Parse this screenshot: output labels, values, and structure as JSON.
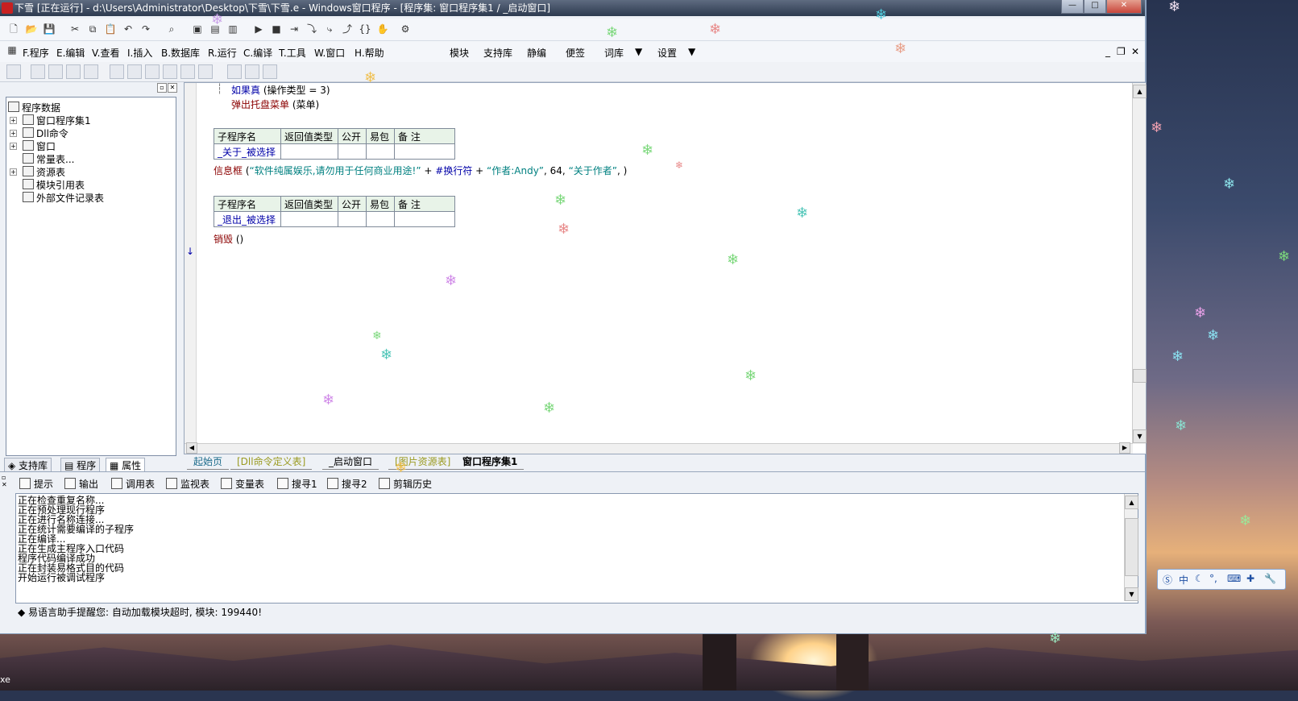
{
  "window": {
    "title": "下雪 [正在运行] - d:\\Users\\Administrator\\Desktop\\下雪\\下雪.e - Windows窗口程序 - [程序集: 窗口程序集1 / _启动窗口]"
  },
  "menu": {
    "items": [
      {
        "key": "F",
        "label": "F.程序"
      },
      {
        "key": "E",
        "label": "E.编辑"
      },
      {
        "key": "V",
        "label": "V.查看"
      },
      {
        "key": "I",
        "label": "I.插入"
      },
      {
        "key": "B",
        "label": "B.数据库"
      },
      {
        "key": "R",
        "label": "R.运行"
      },
      {
        "key": "C",
        "label": "C.编译"
      },
      {
        "key": "T",
        "label": "T.工具"
      },
      {
        "key": "W",
        "label": "W.窗口"
      },
      {
        "key": "H",
        "label": "H.帮助"
      }
    ],
    "right_items": [
      "模块",
      "支持库",
      "静编",
      "便签",
      "词库",
      "设置"
    ]
  },
  "tree": {
    "items": [
      "程序数据",
      "窗口程序集1",
      "Dll命令",
      "窗口",
      "常量表...",
      "资源表",
      "模块引用表",
      "外部文件记录表"
    ]
  },
  "left_tabs": [
    "支持库",
    "程序",
    "属性"
  ],
  "editor": {
    "line_if": "如果真",
    "line_if_args": " (操作类型 = 3)",
    "line_popup": "弹出托盘菜单",
    "line_popup_args": " (菜单)",
    "table_headers": [
      "子程序名",
      "返回值类型",
      "公开",
      "易包",
      "备 注"
    ],
    "sub1_name": "_关于_被选择",
    "msgbox_fn": "信息框",
    "msgbox_open": " (",
    "msgbox_str1": "“软件纯属娱乐,请勿用于任何商业用途!”",
    "msgbox_plus1": " + ",
    "msgbox_newline": "#换行符",
    "msgbox_plus2": " + ",
    "msgbox_str2": "“作者:Andy”",
    "msgbox_num": ", 64, ",
    "msgbox_str3": "“关于作者”",
    "msgbox_close": ", )",
    "sub2_name": "_退出_被选择",
    "destroy_fn": "销毁",
    "destroy_args": " ()"
  },
  "editor_tabs": [
    "起始页",
    "[Dll命令定义表]",
    "_启动窗口",
    "[图片资源表]",
    "窗口程序集1"
  ],
  "bottom_tabs": [
    "提示",
    "输出",
    "调用表",
    "监视表",
    "变量表",
    "搜寻1",
    "搜寻2",
    "剪辑历史"
  ],
  "output_lines": [
    "正在检查重复名称...",
    "正在预处理现行程序",
    "正在进行名称连接...",
    "正在统计需要编译的子程序",
    "正在编译...",
    "正在生成主程序入口代码",
    "程序代码编译成功",
    "正在封装易格式目的代码",
    "开始运行被调试程序"
  ],
  "status_message": "◆ 易语言助手提醒您: 自动加载模块超时, 模块: 199440!",
  "ime": {
    "mode": "中"
  },
  "desktop": {
    "taskbar_fragment": "xe"
  },
  "colors": {
    "keyword_blue": "#0000a8",
    "keyword_red": "#8b0000",
    "string_teal": "#008080"
  }
}
